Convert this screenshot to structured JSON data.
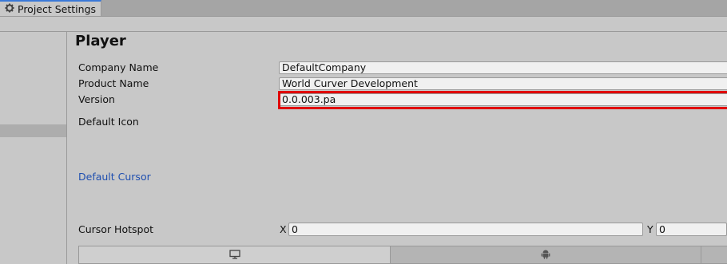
{
  "window": {
    "tab_title": "Project Settings",
    "tab_icon": "gear-icon"
  },
  "player": {
    "title": "Player",
    "company_name_label": "Company Name",
    "company_name_value": "DefaultCompany",
    "product_name_label": "Product Name",
    "product_name_value": "World Curver Development",
    "version_label": "Version",
    "version_value": "0.0.003.pa",
    "default_icon_label": "Default Icon",
    "default_cursor_label": "Default Cursor",
    "cursor_hotspot_label": "Cursor Hotspot",
    "hotspot_x_label": "X",
    "hotspot_x_value": "0",
    "hotspot_y_label": "Y",
    "hotspot_y_value": "0"
  },
  "platform_tabs": [
    {
      "icon": "desktop-monitor-icon",
      "active": true
    },
    {
      "icon": "android-icon",
      "active": false
    }
  ],
  "colors": {
    "highlight": "#e00000",
    "tab_accent": "#3a79d8",
    "link": "#1f4fb0"
  }
}
